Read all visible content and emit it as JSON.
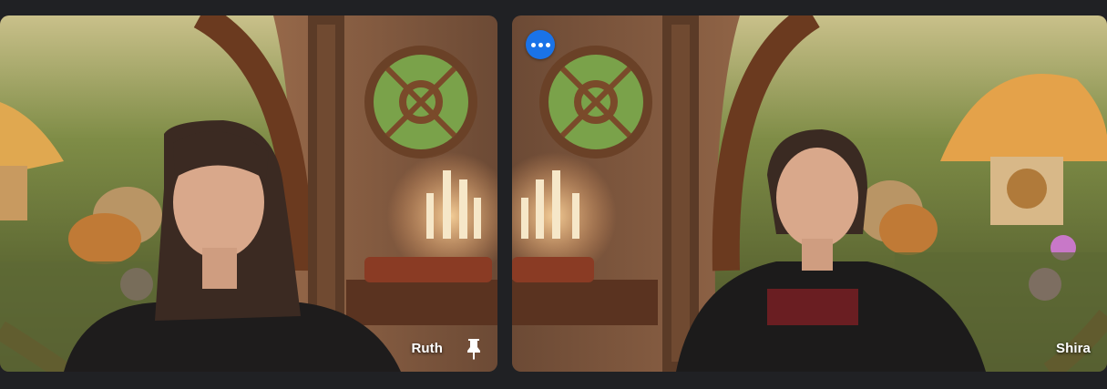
{
  "participants": [
    {
      "name": "Ruth",
      "pinned": true,
      "icons": [
        "pin-icon"
      ]
    },
    {
      "name": "Shira",
      "pinned": false,
      "icons": [
        "more-options-icon"
      ]
    }
  ],
  "colors": {
    "app_background": "#202124",
    "more_button": "#1a73e8",
    "label_text": "#ffffff"
  }
}
